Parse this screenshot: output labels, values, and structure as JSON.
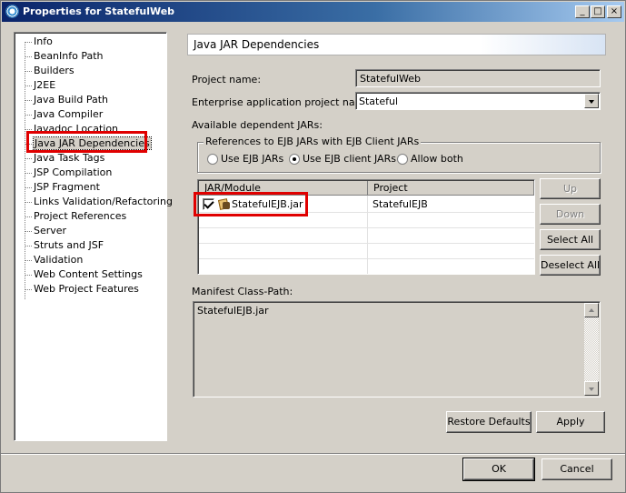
{
  "window": {
    "title": "Properties for StatefulWeb",
    "controls": [
      "_",
      "□",
      "×"
    ]
  },
  "sidebar": {
    "items": [
      {
        "label": "Info"
      },
      {
        "label": "BeanInfo Path"
      },
      {
        "label": "Builders"
      },
      {
        "label": "J2EE"
      },
      {
        "label": "Java Build Path"
      },
      {
        "label": "Java Compiler"
      },
      {
        "label": "Javadoc Location"
      },
      {
        "label": "Java JAR Dependencies",
        "selected": true
      },
      {
        "label": "Java Task Tags"
      },
      {
        "label": "JSP Compilation"
      },
      {
        "label": "JSP Fragment"
      },
      {
        "label": "Links Validation/Refactoring"
      },
      {
        "label": "Project References"
      },
      {
        "label": "Server"
      },
      {
        "label": "Struts and JSF"
      },
      {
        "label": "Validation"
      },
      {
        "label": "Web Content Settings"
      },
      {
        "label": "Web Project Features"
      }
    ]
  },
  "page": {
    "title": "Java JAR Dependencies",
    "project_name_label": "Project name:",
    "project_name_value": "StatefulWeb",
    "ear_label": "Enterprise application project name:",
    "ear_value": "Stateful",
    "available_label": "Available dependent JARs:",
    "ejb_group": {
      "legend": "References to EJB JARs with EJB Client JARs",
      "options": [
        "Use EJB JARs",
        "Use EJB client JARs",
        "Allow both"
      ],
      "selected_index": 1
    },
    "table": {
      "columns": [
        "JAR/Module",
        "Project"
      ],
      "rows": [
        {
          "module": "StatefulEJB.jar",
          "project": "StatefulEJB",
          "checked": true
        }
      ]
    },
    "buttons": {
      "up": "Up",
      "down": "Down",
      "select_all": "Select All",
      "deselect_all": "Deselect All"
    },
    "manifest_label": "Manifest Class-Path:",
    "manifest_value": "StatefulEJB.jar",
    "restore_defaults": "Restore Defaults",
    "apply": "Apply"
  },
  "footer": {
    "ok": "OK",
    "cancel": "Cancel"
  },
  "colors": {
    "titlebar_start": "#0a246a",
    "titlebar_end": "#a6caf0",
    "highlight": "#e00000",
    "dialog_bg": "#d4d0c8"
  }
}
